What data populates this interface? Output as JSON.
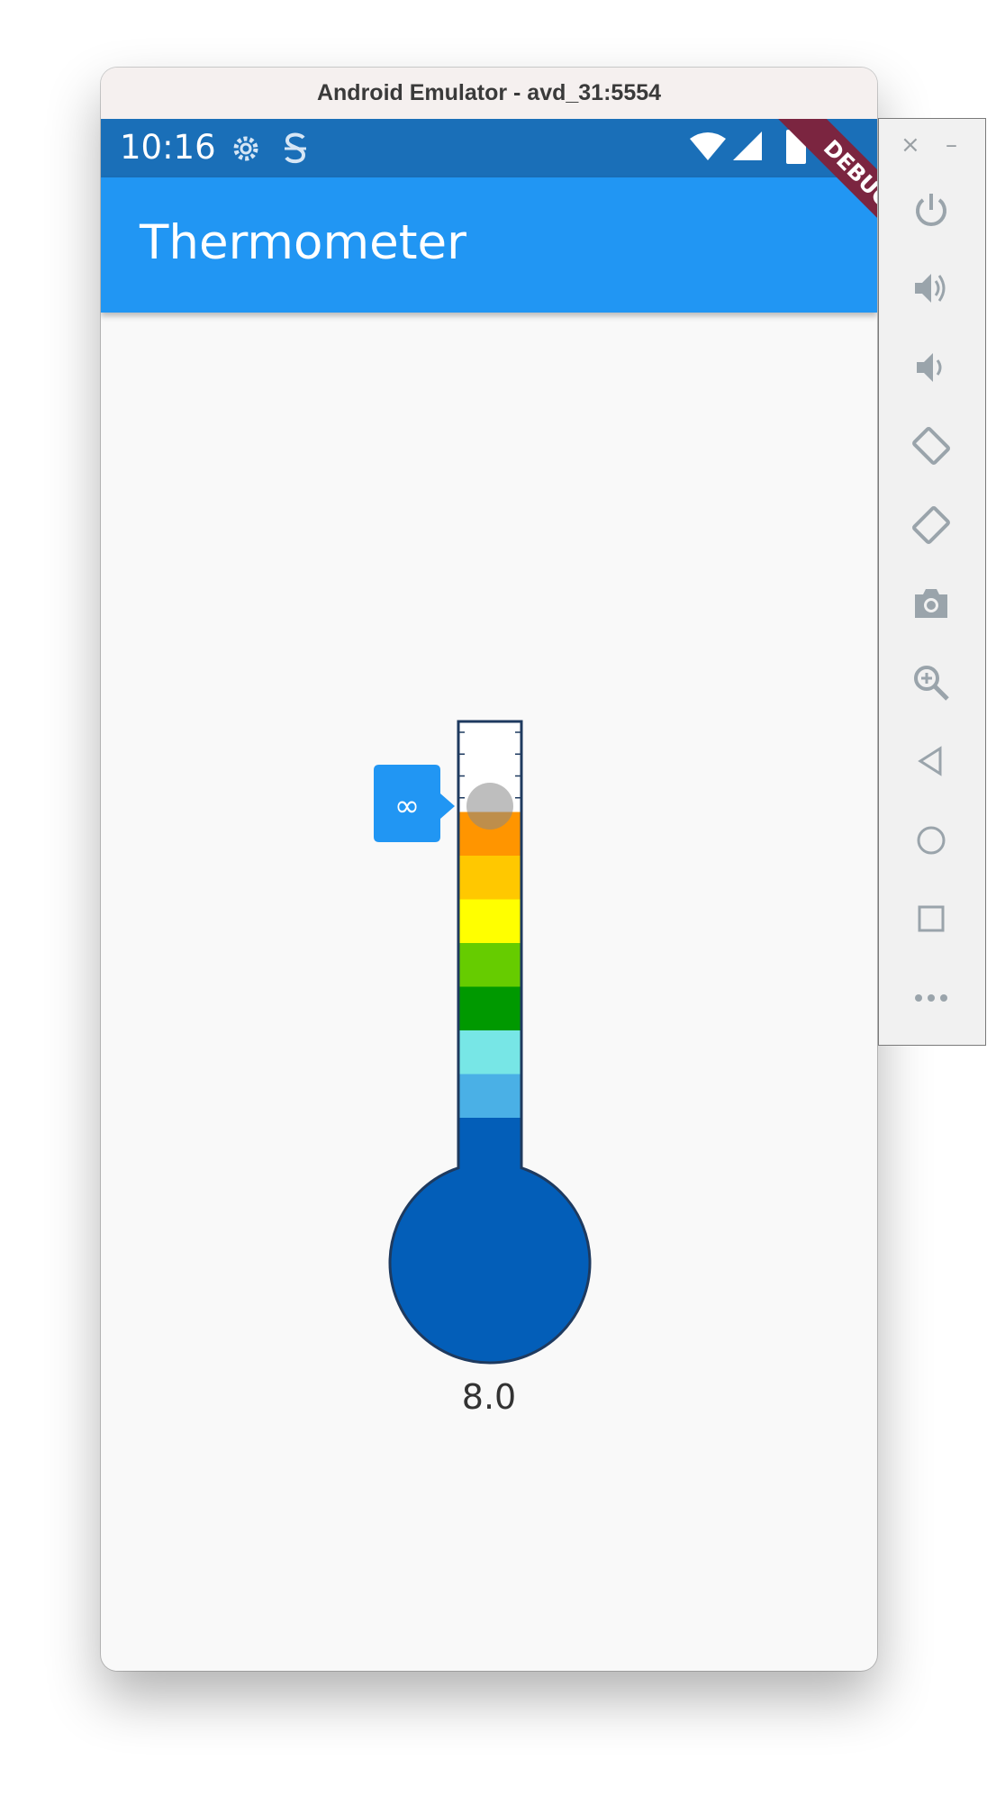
{
  "window": {
    "title": "Android Emulator - avd_31:5554"
  },
  "status_bar": {
    "time": "10:16",
    "icons": [
      "gear-icon",
      "s-notification-icon",
      "wifi-icon",
      "signal-icon",
      "battery-icon"
    ]
  },
  "debug_banner": {
    "label": "DEBUG",
    "color": "#7b2540"
  },
  "app_bar": {
    "title": "Thermometer",
    "color": "#2196f3"
  },
  "thermometer": {
    "value": 8.0,
    "value_label": "8.0",
    "pointer_label": "∞",
    "band_colors": [
      "#ff9500",
      "#ffc800",
      "#ffff00",
      "#66cc00",
      "#009900",
      "#77e6e6",
      "#4ab0e6"
    ],
    "fill_color": "#035eb8",
    "outline_color": "#1e3a5f"
  },
  "side_panel": {
    "controls": [
      {
        "name": "power-icon"
      },
      {
        "name": "volume-up-icon"
      },
      {
        "name": "volume-down-icon"
      },
      {
        "name": "rotate-left-icon"
      },
      {
        "name": "rotate-right-icon"
      },
      {
        "name": "camera-icon"
      },
      {
        "name": "zoom-icon"
      },
      {
        "name": "back-icon"
      },
      {
        "name": "home-icon"
      },
      {
        "name": "overview-icon"
      },
      {
        "name": "more-icon"
      }
    ],
    "close_label": "×",
    "minimize_label": "–"
  }
}
